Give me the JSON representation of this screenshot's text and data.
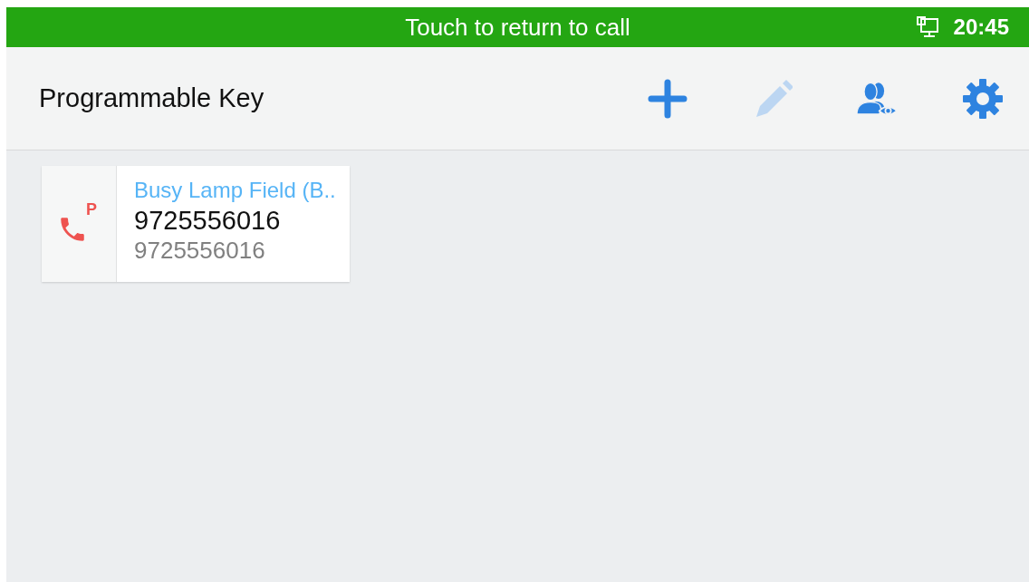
{
  "status_bar": {
    "message": "Touch to return to call",
    "time": "20:45"
  },
  "header": {
    "title": "Programmable Key",
    "actions": [
      {
        "kind": "add",
        "disabled": false
      },
      {
        "kind": "edit",
        "disabled": true
      },
      {
        "kind": "contacts",
        "disabled": false
      },
      {
        "kind": "settings",
        "disabled": false
      }
    ]
  },
  "keys": [
    {
      "icon_letter": "P",
      "mode": "Busy Lamp Field (B..",
      "name": "9725556016",
      "number": "9725556016"
    }
  ]
}
